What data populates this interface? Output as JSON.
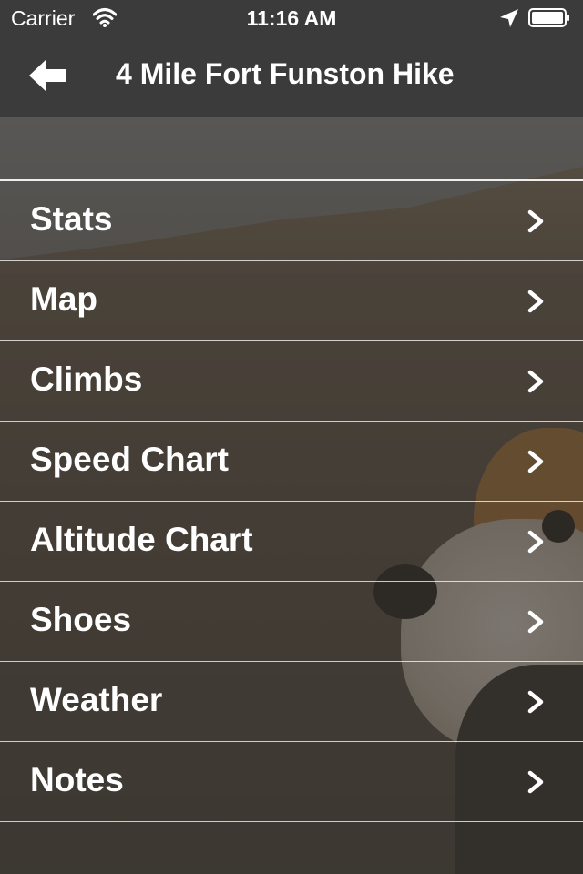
{
  "status_bar": {
    "carrier": "Carrier",
    "time": "11:16 AM",
    "wifi_icon": "wifi-icon",
    "location_icon": "location-arrow-icon",
    "battery_icon": "battery-icon"
  },
  "nav": {
    "back_icon": "back-arrow-icon",
    "title": "4 Mile Fort Funston Hike"
  },
  "menu": {
    "chevron_icon": "chevron-right-icon",
    "items": [
      {
        "label": "Stats"
      },
      {
        "label": "Map"
      },
      {
        "label": "Climbs"
      },
      {
        "label": "Speed Chart"
      },
      {
        "label": "Altitude Chart"
      },
      {
        "label": "Shoes"
      },
      {
        "label": "Weather"
      },
      {
        "label": "Notes"
      }
    ]
  },
  "colors": {
    "bar_background": "#3b3b3b",
    "text": "#ffffff",
    "row_divider": "#ffffff"
  }
}
